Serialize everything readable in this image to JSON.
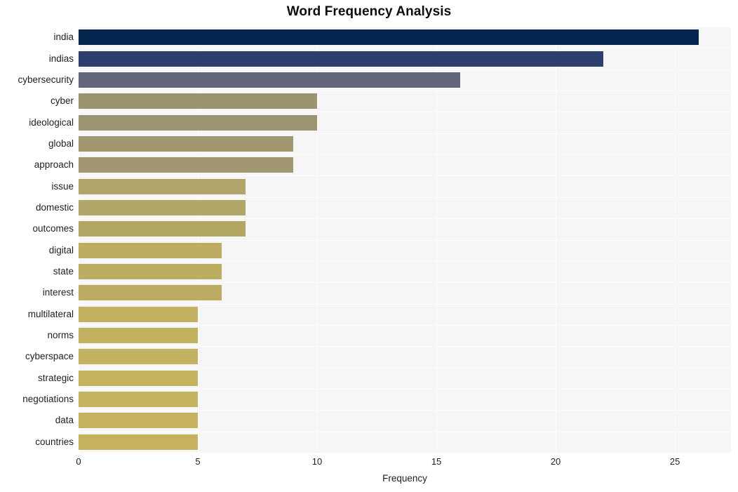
{
  "chart_data": {
    "type": "bar",
    "orientation": "horizontal",
    "title": "Word Frequency Analysis",
    "xlabel": "Frequency",
    "ylabel": "",
    "xlim": [
      0,
      27.35
    ],
    "ylim_categories": 20,
    "grid": true,
    "legend": null,
    "xticks": [
      0,
      5,
      10,
      15,
      20,
      25
    ],
    "xtick_labels": [
      "0",
      "5",
      "10",
      "15",
      "20",
      "25"
    ],
    "categories": [
      "india",
      "indias",
      "cybersecurity",
      "cyber",
      "ideological",
      "global",
      "approach",
      "issue",
      "domestic",
      "outcomes",
      "digital",
      "state",
      "interest",
      "multilateral",
      "norms",
      "cyberspace",
      "strategic",
      "negotiations",
      "data",
      "countries"
    ],
    "values": [
      26,
      22,
      16,
      10,
      10,
      9,
      9,
      7,
      7,
      7,
      6,
      6,
      6,
      5,
      5,
      5,
      5,
      5,
      5,
      5
    ],
    "bar_colors": [
      "#04254d",
      "#2c3f6d",
      "#62667a",
      "#9c9471",
      "#9d9571",
      "#a19872",
      "#a19872",
      "#b0a46a",
      "#b2a668",
      "#b4a766",
      "#bcad62",
      "#bcad62",
      "#bcad62",
      "#c2b160",
      "#c2b160",
      "#c2b15f",
      "#c4b25f",
      "#c5b25e",
      "#c6b25e",
      "#c6b25e"
    ],
    "plot_background": "#f6f6f7",
    "figure_background": "#ffffff",
    "gridline_color": "#ffffff"
  },
  "axis": {
    "x_label": "Frequency",
    "title": "Word Frequency Analysis"
  }
}
